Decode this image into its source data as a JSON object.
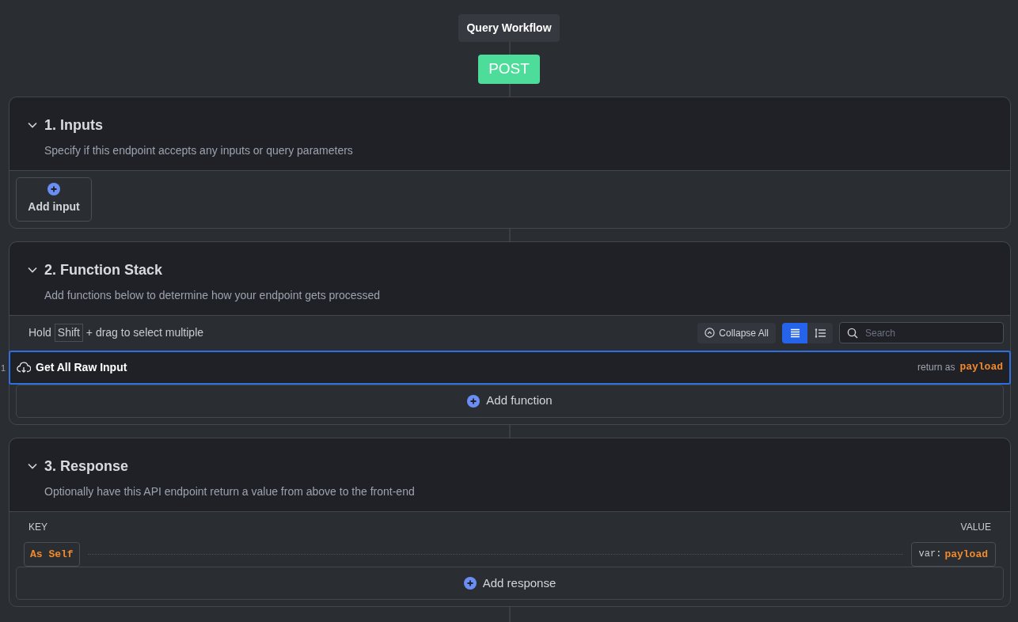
{
  "workflow": {
    "title": "Query Workflow",
    "method": "POST"
  },
  "inputs": {
    "title": "1. Inputs",
    "description": "Specify if this endpoint accepts any inputs or query parameters",
    "expanded": true,
    "add_label": "Add input"
  },
  "function_stack": {
    "title": "2. Function Stack",
    "description": "Add functions below to determine how your endpoint gets processed",
    "expanded": true,
    "hint": {
      "before": "Hold",
      "key": "Shift",
      "after": "+ drag to select multiple"
    },
    "collapse_label": "Collapse All",
    "view_modes": [
      {
        "kind": "list",
        "selected": true
      },
      {
        "kind": "numbered",
        "selected": false
      }
    ],
    "search": {
      "placeholder": "Search"
    },
    "functions": [
      {
        "number": "1",
        "name": "Get All Raw Input",
        "return_label": "return as",
        "return_var": "payload",
        "selected": true
      }
    ],
    "add_label": "Add function"
  },
  "response": {
    "title": "3. Response",
    "description": "Optionally have this API endpoint return a value from above to the front-end",
    "expanded": true,
    "columns": [
      "KEY",
      "VALUE"
    ],
    "rows": [
      {
        "key": "As Self",
        "value_prefix": "var:",
        "value": "payload"
      }
    ],
    "add_label": "Add response"
  }
}
